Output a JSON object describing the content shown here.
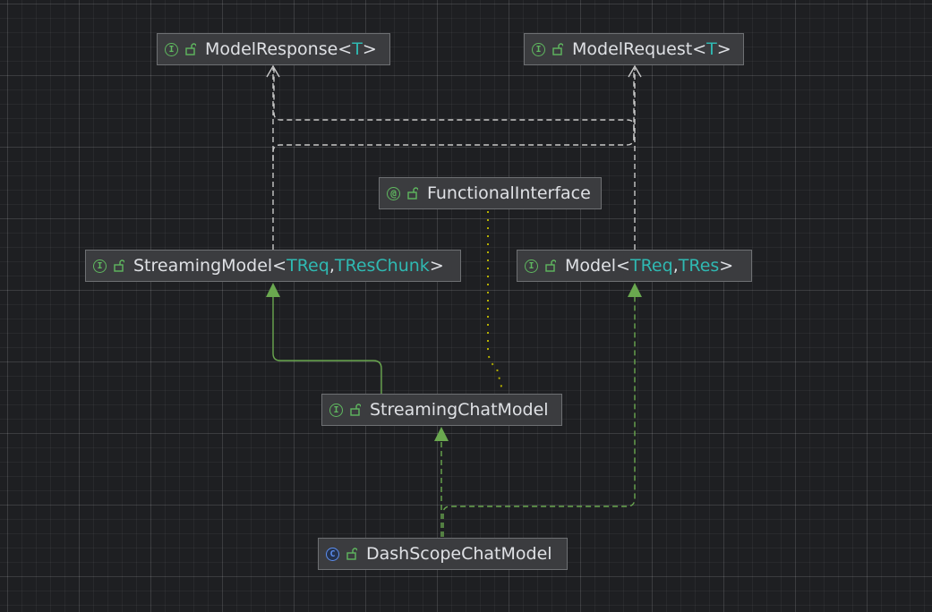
{
  "diagram": {
    "nodes": {
      "model_response": {
        "kind": "I",
        "name": "ModelResponse<",
        "params": "T",
        "close": ">"
      },
      "model_request": {
        "kind": "I",
        "name": "ModelRequest<",
        "params": "T",
        "close": ">"
      },
      "functional_interface": {
        "kind": "@",
        "name": "FunctionalInterface"
      },
      "streaming_model": {
        "kind": "I",
        "name": "StreamingModel<",
        "param1": "TReq",
        "sep": ", ",
        "param2": "TResChunk",
        "close": " >"
      },
      "model": {
        "kind": "I",
        "name": "Model<",
        "param1": "TReq",
        "sep": ", ",
        "param2": "TRes",
        "close": ">"
      },
      "streaming_chat_model": {
        "kind": "I",
        "name": "StreamingChatModel"
      },
      "dashscope_chat_model": {
        "kind": "C",
        "name": "DashScopeChatModel"
      }
    },
    "edges": [
      {
        "from": "StreamingModel",
        "to": "ModelResponse",
        "type": "dependency"
      },
      {
        "from": "StreamingModel",
        "to": "ModelRequest",
        "type": "dependency"
      },
      {
        "from": "Model",
        "to": "ModelResponse",
        "type": "dependency"
      },
      {
        "from": "Model",
        "to": "ModelRequest",
        "type": "dependency"
      },
      {
        "from": "StreamingChatModel",
        "to": "StreamingModel",
        "type": "extends"
      },
      {
        "from": "StreamingChatModel",
        "to": "FunctionalInterface",
        "type": "annotated"
      },
      {
        "from": "DashScopeChatModel",
        "to": "StreamingChatModel",
        "type": "implements"
      },
      {
        "from": "DashScopeChatModel",
        "to": "Model",
        "type": "implements"
      }
    ],
    "colors": {
      "background": "#1e1f22",
      "node_fill": "#3b3c3f",
      "dependency_edge": "#c8c8c8",
      "inheritance_edge": "#6aa84f",
      "annotation_edge": "#b5b000",
      "type_param": "#2fb9b2",
      "interface_icon": "#5fb85f",
      "class_icon": "#5c8ef0"
    }
  }
}
